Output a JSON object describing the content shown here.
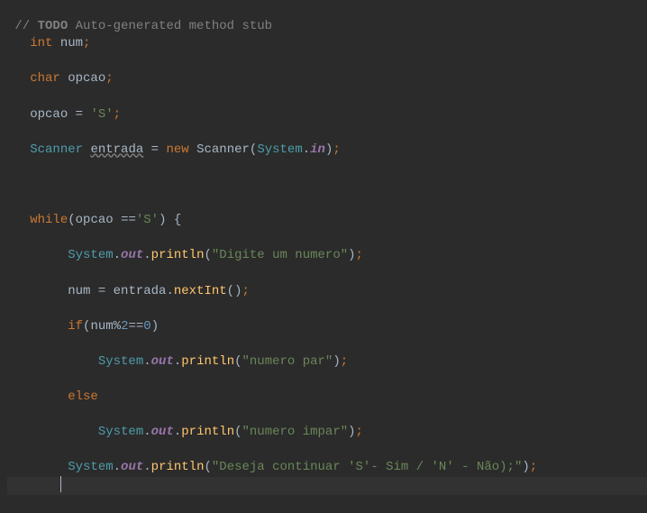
{
  "lines": {
    "l1_comment_prefix": "// ",
    "l1_comment_todo": "TODO",
    "l1_comment_rest": " Auto-generated method stub",
    "l2_kw_int": "int",
    "l2_num": " num",
    "l2_semi": ";",
    "l3_kw_char": "char",
    "l3_opcao": " opcao",
    "l3_semi": ";",
    "l4_opcao": "opcao ",
    "l4_eq": "= ",
    "l4_char": "'S'",
    "l4_semi": ";",
    "l5_scanner": "Scanner ",
    "l5_entrada": "entrada",
    "l5_eq": " = ",
    "l5_new": "new",
    "l5_scanner2": " Scanner",
    "l5_paren1": "(",
    "l5_system": "System",
    "l5_dot": ".",
    "l5_in": "in",
    "l5_paren2": ")",
    "l5_semi": ";",
    "l6_while": "while",
    "l6_paren1": "(",
    "l6_opcao": "opcao ",
    "l6_eqeq": "==",
    "l6_char": "'S'",
    "l6_paren2": ") {",
    "l7_system": "System",
    "l7_dot1": ".",
    "l7_out": "out",
    "l7_dot2": ".",
    "l7_println": "println",
    "l7_paren1": "(",
    "l7_str": "\"Digite um numero\"",
    "l7_paren2": ")",
    "l7_semi": ";",
    "l8_num": "num ",
    "l8_eq": "= ",
    "l8_entrada": "entrada",
    "l8_dot": ".",
    "l8_nextint": "nextInt",
    "l8_paren": "()",
    "l8_semi": ";",
    "l9_if": "if",
    "l9_paren1": "(",
    "l9_num": "num",
    "l9_mod": "%",
    "l9_two": "2",
    "l9_eqeq": "==",
    "l9_zero": "0",
    "l9_paren2": ")",
    "l10_system": "System",
    "l10_dot1": ".",
    "l10_out": "out",
    "l10_dot2": ".",
    "l10_println": "println",
    "l10_paren1": "(",
    "l10_str": "\"numero par\"",
    "l10_paren2": ")",
    "l10_semi": ";",
    "l11_else": "else",
    "l12_system": "System",
    "l12_dot1": ".",
    "l12_out": "out",
    "l12_dot2": ".",
    "l12_println": "println",
    "l12_paren1": "(",
    "l12_str": "\"numero impar\"",
    "l12_paren2": ")",
    "l12_semi": ";",
    "l13_system": "System",
    "l13_dot1": ".",
    "l13_out": "out",
    "l13_dot2": ".",
    "l13_println": "println",
    "l13_paren1": "(",
    "l13_str": "\"Deseja continuar 'S'- Sim / 'N' - Não);\"",
    "l13_paren2": ")",
    "l13_semi": ";"
  }
}
